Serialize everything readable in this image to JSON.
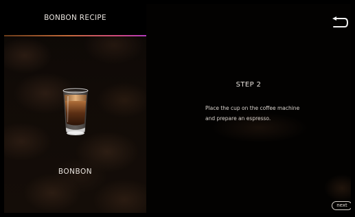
{
  "header": {
    "title": "BONBON RECIPE"
  },
  "drink": {
    "name": "BONBON",
    "image_icon": "espresso-glass-icon"
  },
  "step": {
    "title": "STEP 2",
    "instruction_line1": "Place the cup on the coffee machine",
    "instruction_line2": "and prepare an espresso."
  },
  "nav": {
    "back_icon": "back-arrow-icon",
    "next_label": "next"
  },
  "colors": {
    "background": "#000000",
    "text": "#e8e3de",
    "header_line_start": "#6b3c1a",
    "header_line_end": "#b33bbf"
  }
}
